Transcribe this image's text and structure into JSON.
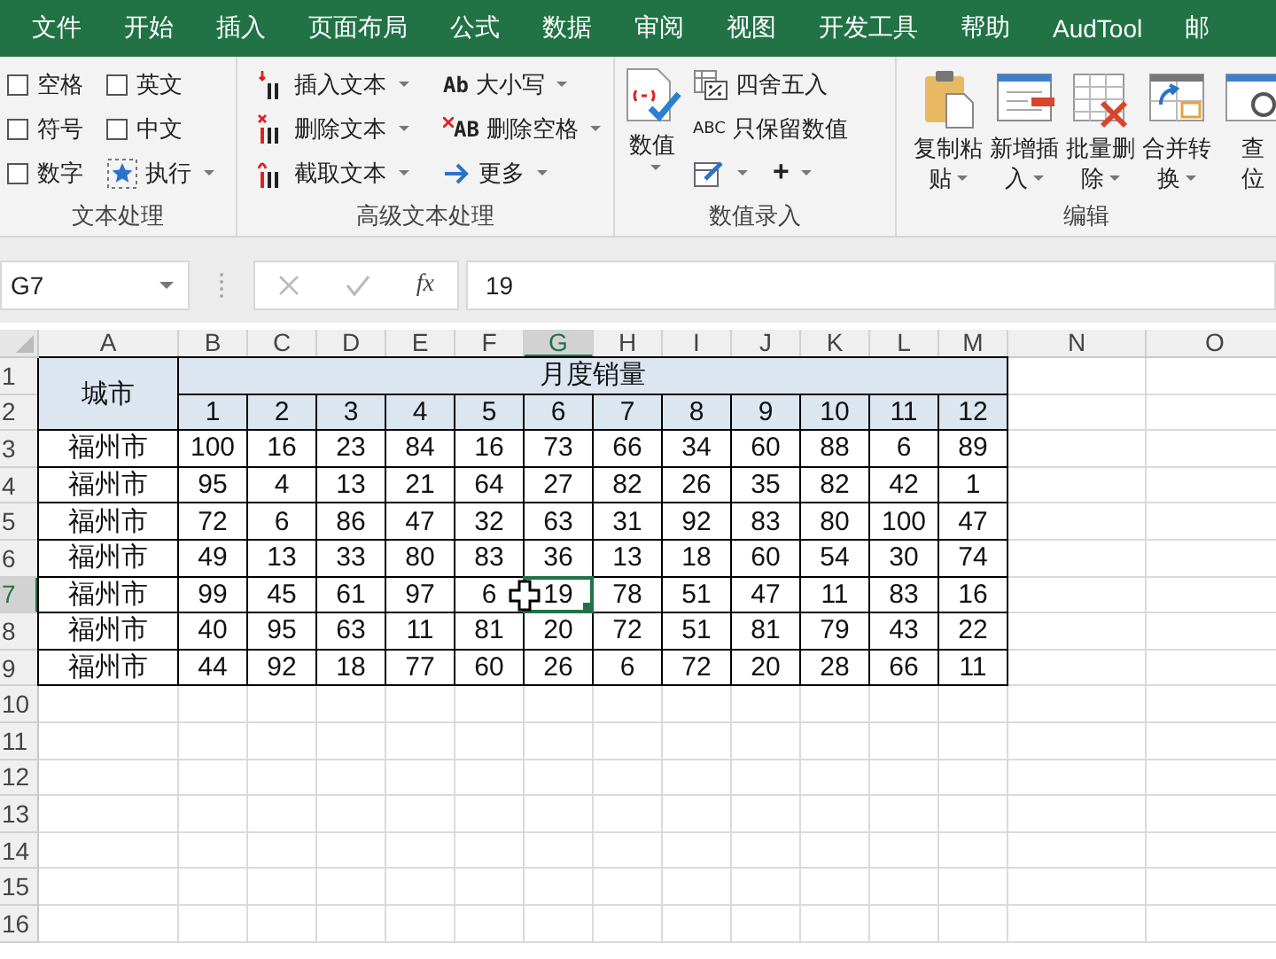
{
  "tabs": [
    {
      "label": "文件"
    },
    {
      "label": "开始"
    },
    {
      "label": "插入"
    },
    {
      "label": "页面布局"
    },
    {
      "label": "公式"
    },
    {
      "label": "数据"
    },
    {
      "label": "审阅"
    },
    {
      "label": "视图"
    },
    {
      "label": "开发工具"
    },
    {
      "label": "帮助"
    },
    {
      "label": "AudTool"
    },
    {
      "label": "邮"
    }
  ],
  "ribbon": {
    "groups": [
      {
        "kind": "checks",
        "label": "文本处理",
        "checkboxes": [
          {
            "label": "空格",
            "checked": false
          },
          {
            "label": "英文",
            "checked": false
          },
          {
            "label": "符号",
            "checked": false
          },
          {
            "label": "中文",
            "checked": false
          },
          {
            "label": "数字",
            "checked": false
          }
        ],
        "run_button": {
          "label": "执行",
          "dropdown": true
        }
      },
      {
        "kind": "text_tools",
        "label": "高级文本处理",
        "buttons": [
          {
            "label": "插入文本",
            "dropdown": true
          },
          {
            "label": "删除文本",
            "dropdown": true
          },
          {
            "label": "截取文本",
            "dropdown": true
          },
          {
            "label": "大小写",
            "icon_text": "Ab",
            "dropdown": true
          },
          {
            "label": "删除空格",
            "icon_text": "AB",
            "dropdown": true
          },
          {
            "label": "更多",
            "dropdown": true
          }
        ]
      },
      {
        "kind": "number_entry",
        "label": "数值录入",
        "big_button": {
          "label": "数值",
          "dropdown": true
        },
        "buttons": [
          {
            "label": "四舍五入"
          },
          {
            "label": "只保留数值",
            "icon_text": "ABC"
          }
        ],
        "small_buttons": [
          {
            "dropdown": true
          },
          {
            "text": "+",
            "dropdown": true
          }
        ]
      },
      {
        "kind": "large_buttons",
        "label": "编辑",
        "buttons": [
          {
            "lines": [
              "复制粘",
              "贴"
            ],
            "dropdown": true
          },
          {
            "lines": [
              "新增插",
              "入"
            ],
            "dropdown": true
          },
          {
            "lines": [
              "批量删",
              "除"
            ],
            "dropdown": true
          },
          {
            "lines": [
              "合并转",
              "换"
            ],
            "dropdown": true
          },
          {
            "lines": [
              "查",
              "位"
            ],
            "dropdown": false
          }
        ]
      }
    ]
  },
  "formula_bar": {
    "name_box": "G7",
    "fx": "fx",
    "formula": "19"
  },
  "sheet": {
    "columns": [
      {
        "label": "A",
        "selected": false
      },
      {
        "label": "B",
        "selected": false
      },
      {
        "label": "C",
        "selected": false
      },
      {
        "label": "D",
        "selected": false
      },
      {
        "label": "E",
        "selected": false
      },
      {
        "label": "F",
        "selected": false
      },
      {
        "label": "G",
        "selected": true
      },
      {
        "label": "H",
        "selected": false
      },
      {
        "label": "I",
        "selected": false
      },
      {
        "label": "J",
        "selected": false
      },
      {
        "label": "K",
        "selected": false
      },
      {
        "label": "L",
        "selected": false
      },
      {
        "label": "M",
        "selected": false
      },
      {
        "label": "N",
        "selected": false
      },
      {
        "label": "O",
        "selected": false
      }
    ],
    "row_headers": [
      {
        "label": "1",
        "selected": false
      },
      {
        "label": "2",
        "selected": false
      },
      {
        "label": "3",
        "selected": false
      },
      {
        "label": "4",
        "selected": false
      },
      {
        "label": "5",
        "selected": false
      },
      {
        "label": "6",
        "selected": false
      },
      {
        "label": "7",
        "selected": true
      },
      {
        "label": "8",
        "selected": false
      },
      {
        "label": "9",
        "selected": false
      },
      {
        "label": "10",
        "selected": false
      },
      {
        "label": "11",
        "selected": false
      },
      {
        "label": "12",
        "selected": false
      },
      {
        "label": "13",
        "selected": false
      },
      {
        "label": "14",
        "selected": false
      },
      {
        "label": "15",
        "selected": false
      },
      {
        "label": "16",
        "selected": false
      }
    ],
    "table": {
      "corner_header": "城市",
      "group_header": "月度销量",
      "months": [
        "1",
        "2",
        "3",
        "4",
        "5",
        "6",
        "7",
        "8",
        "9",
        "10",
        "11",
        "12"
      ],
      "rows": [
        {
          "city": "福州市",
          "values": [
            "100",
            "16",
            "23",
            "84",
            "16",
            "73",
            "66",
            "34",
            "60",
            "88",
            "6",
            "89"
          ]
        },
        {
          "city": "福州市",
          "values": [
            "95",
            "4",
            "13",
            "21",
            "64",
            "27",
            "82",
            "26",
            "35",
            "82",
            "42",
            "1"
          ]
        },
        {
          "city": "福州市",
          "values": [
            "72",
            "6",
            "86",
            "47",
            "32",
            "63",
            "31",
            "92",
            "83",
            "80",
            "100",
            "47"
          ]
        },
        {
          "city": "福州市",
          "values": [
            "49",
            "13",
            "33",
            "80",
            "83",
            "36",
            "13",
            "18",
            "60",
            "54",
            "30",
            "74"
          ]
        },
        {
          "city": "福州市",
          "values": [
            "99",
            "45",
            "61",
            "97",
            "6",
            "19",
            "78",
            "51",
            "47",
            "11",
            "83",
            "16"
          ]
        },
        {
          "city": "福州市",
          "values": [
            "40",
            "95",
            "63",
            "11",
            "81",
            "20",
            "72",
            "51",
            "81",
            "79",
            "43",
            "22"
          ]
        },
        {
          "city": "福州市",
          "values": [
            "44",
            "92",
            "18",
            "77",
            "60",
            "26",
            "6",
            "72",
            "20",
            "28",
            "66",
            "11"
          ]
        }
      ]
    }
  }
}
